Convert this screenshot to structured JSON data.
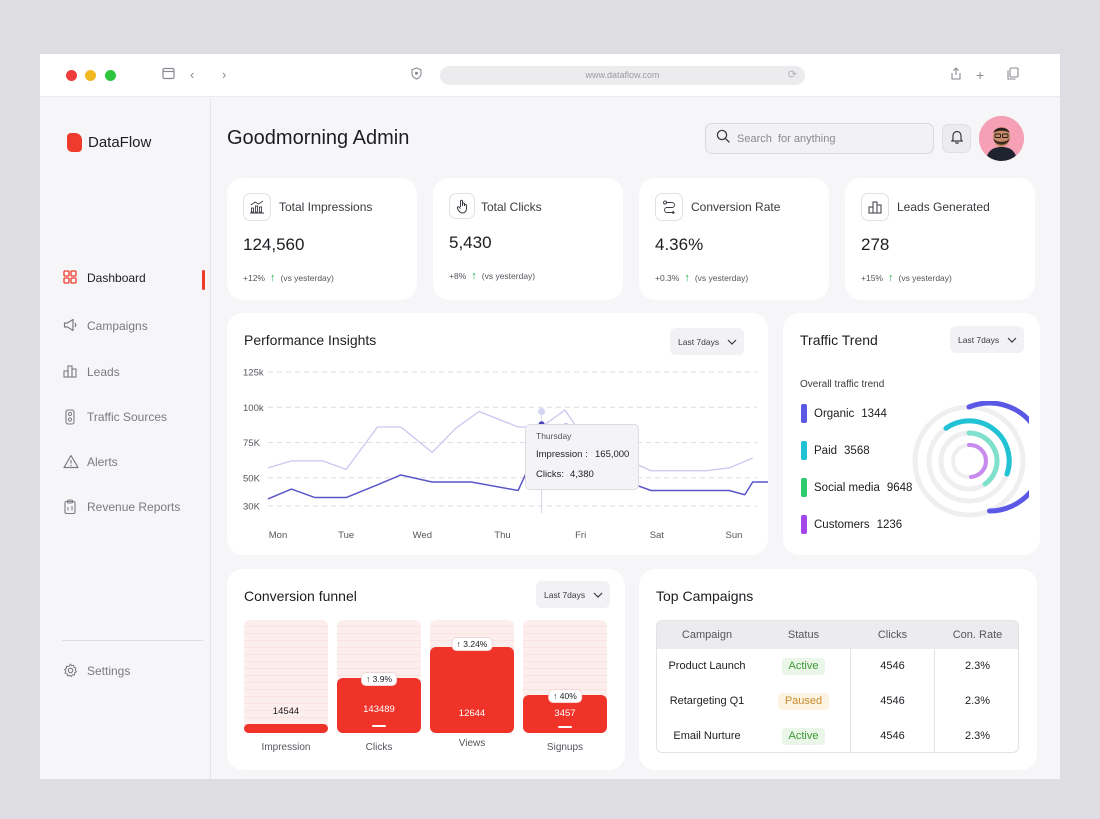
{
  "browser": {
    "url": "www.dataflow.com",
    "traffic_lights": [
      "#ef3b3b",
      "#f2b820",
      "#2fc43d"
    ]
  },
  "brand": {
    "name": "DataFlow",
    "accent": "#ef3b2c"
  },
  "sidebar": {
    "items": [
      {
        "label": "Dashboard",
        "icon": "grid-icon",
        "active": true
      },
      {
        "label": "Campaigns",
        "icon": "megaphone-icon"
      },
      {
        "label": "Leads",
        "icon": "chart-bars-icon"
      },
      {
        "label": "Traffic Sources",
        "icon": "traffic-light-icon"
      },
      {
        "label": "Alerts",
        "icon": "warning-icon"
      },
      {
        "label": "Revenue Reports",
        "icon": "clipboard-icon"
      }
    ],
    "settings_label": "Settings"
  },
  "header": {
    "greeting": "Goodmorning Admin",
    "search_placeholder": "Search  for anything"
  },
  "kpis": [
    {
      "label": "Total Impressions",
      "value": "124,560",
      "delta": "+12%",
      "compare": "(vs yesterday)",
      "icon": "impressions-chart-icon"
    },
    {
      "label": "Total Clicks",
      "value": "5,430",
      "delta": "+8%",
      "compare": "(vs yesterday)",
      "icon": "hand-pointer-icon"
    },
    {
      "label": "Conversion Rate",
      "value": "4.36%",
      "delta": "+0.3%",
      "compare": "(vs yesterday)",
      "icon": "route-icon"
    },
    {
      "label": "Leads Generated",
      "value": "278",
      "delta": "+15%",
      "compare": "(vs yesterday)",
      "icon": "leads-bars-icon"
    }
  ],
  "performance": {
    "title": "Performance Insights",
    "range": "Last 7days",
    "tooltip": {
      "day": "Thursday",
      "impression_label": "Impression :",
      "impression_value": "165,000",
      "clicks_label": "Clicks:",
      "clicks_value": "4,380"
    }
  },
  "traffic": {
    "title": "Traffic Trend",
    "range": "Last 7days",
    "subtitle": "Overall traffic trend",
    "items": [
      {
        "label": "Organic",
        "value": "1344",
        "color": "#5b58e6"
      },
      {
        "label": "Paid",
        "value": "3568",
        "color": "#21c2d4"
      },
      {
        "label": "Social media",
        "value": "9648",
        "color": "#2ecc71"
      },
      {
        "label": "Customers",
        "value": "1236",
        "color": "#a347e8"
      }
    ]
  },
  "funnel": {
    "title": "Conversion funnel",
    "range": "Last 7days",
    "stages": [
      {
        "label": "Impression",
        "value": "14544",
        "change": "",
        "fill": 0.08
      },
      {
        "label": "Clicks",
        "value": "143489",
        "change": "3.9%",
        "fill": 0.49
      },
      {
        "label": "Views",
        "value": "12644",
        "change": "3.24%",
        "fill": 0.98
      },
      {
        "label": "Signups",
        "value": "3457",
        "change": "40%",
        "fill": 0.41
      }
    ]
  },
  "campaigns": {
    "title": "Top Campaigns",
    "columns": [
      "Campaign",
      "Status",
      "Clicks",
      "Con. Rate"
    ],
    "rows": [
      {
        "name": "Product Launch",
        "status": "Active",
        "clicks": "4546",
        "rate": "2.3%"
      },
      {
        "name": "Retargeting Q1",
        "status": "Paused",
        "clicks": "4546",
        "rate": "2.3%"
      },
      {
        "name": "Email Nurture",
        "status": "Active",
        "clicks": "4546",
        "rate": "2.3%"
      }
    ]
  },
  "chart_data": {
    "type": "line",
    "title": "Performance Insights",
    "categories": [
      "Mon",
      "Tue",
      "Wed",
      "Thu",
      "Fri",
      "Sat",
      "Sun"
    ],
    "y_ticks": [
      "125k",
      "100k",
      "75K",
      "50K",
      "30K"
    ],
    "series": [
      {
        "name": "Impression",
        "color": "#c9c7ef",
        "x": [
          0,
          0.3,
          0.7,
          1,
          1.4,
          1.7,
          2.1,
          2.4,
          2.7,
          3.2,
          3.5,
          3.8,
          4.2,
          4.5,
          4.9,
          5.2,
          5.6,
          5.9,
          6.2
        ],
        "y": [
          57,
          62,
          62,
          56,
          86,
          86,
          68,
          85,
          97,
          86,
          86,
          98,
          65,
          65,
          55,
          55,
          55,
          57,
          64
        ]
      },
      {
        "name": "Clicks",
        "color": "#5c56c8",
        "x": [
          0,
          0.3,
          0.6,
          1,
          1.4,
          1.7,
          2.1,
          2.6,
          3.2,
          3.5,
          3.8,
          4.2,
          4.6,
          4.9,
          5.3,
          5.6,
          5.9,
          6.1,
          6.2,
          6.4
        ],
        "y": [
          35,
          42,
          36,
          36,
          45,
          52,
          47,
          47,
          41,
          77,
          88,
          85,
          47,
          41,
          41,
          41,
          41,
          38,
          47,
          47
        ]
      }
    ],
    "highlight": {
      "category": "Thu",
      "impression": 165000,
      "clicks": 4380
    },
    "grid": true
  }
}
